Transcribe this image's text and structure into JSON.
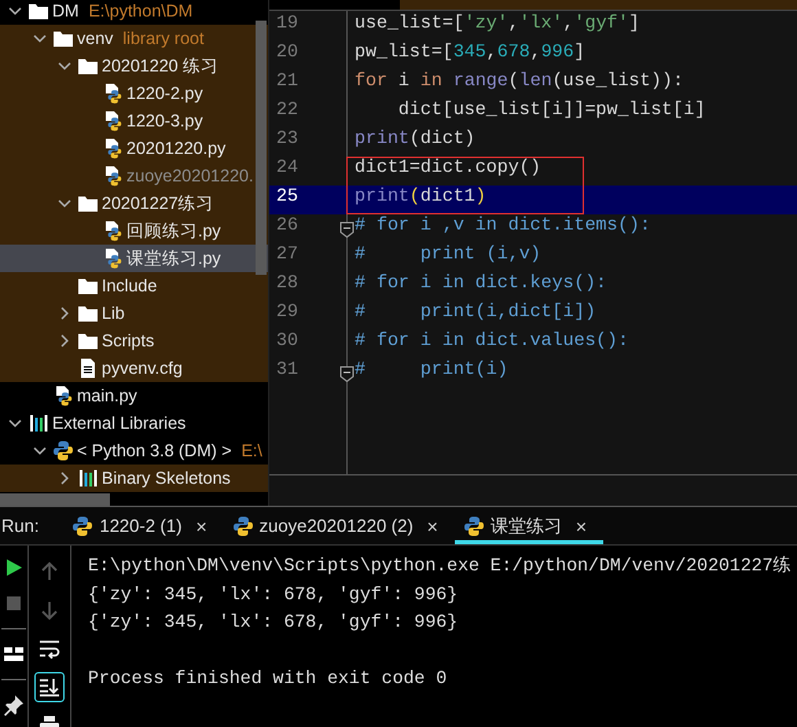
{
  "project_tree": {
    "items": [
      {
        "label": "DM",
        "detail": "E:\\python\\DM",
        "kind": "folder",
        "expanded": true,
        "selected": false,
        "dimmed": false,
        "library": false,
        "children": [
          {
            "label": "venv",
            "detail": "library root",
            "kind": "folder",
            "expanded": true,
            "selected": false,
            "dimmed": false,
            "library": true,
            "children": [
              {
                "label": "20201220 练习",
                "kind": "folder",
                "expanded": true,
                "selected": false,
                "dimmed": false,
                "library": true,
                "children": [
                  {
                    "label": "1220-2.py",
                    "kind": "python-file",
                    "selected": false,
                    "dimmed": false,
                    "library": true
                  },
                  {
                    "label": "1220-3.py",
                    "kind": "python-file",
                    "selected": false,
                    "dimmed": false,
                    "library": true
                  },
                  {
                    "label": "20201220.py",
                    "kind": "python-file",
                    "selected": false,
                    "dimmed": false,
                    "library": true
                  },
                  {
                    "label": "zuoye20201220.",
                    "kind": "python-file",
                    "selected": false,
                    "dimmed": true,
                    "library": true
                  }
                ]
              },
              {
                "label": "20201227练习",
                "kind": "folder",
                "expanded": true,
                "selected": false,
                "dimmed": false,
                "library": true,
                "children": [
                  {
                    "label": "回顾练习.py",
                    "kind": "python-file",
                    "selected": false,
                    "dimmed": false,
                    "library": true
                  },
                  {
                    "label": "课堂练习.py",
                    "kind": "python-file",
                    "selected": true,
                    "dimmed": false,
                    "library": true
                  }
                ]
              },
              {
                "label": "Include",
                "kind": "folder",
                "selected": false,
                "dimmed": false,
                "library": true
              },
              {
                "label": "Lib",
                "kind": "folder",
                "expanded": false,
                "selected": false,
                "dimmed": false,
                "library": true
              },
              {
                "label": "Scripts",
                "kind": "folder",
                "expanded": false,
                "selected": false,
                "dimmed": false,
                "library": true
              },
              {
                "label": "pyvenv.cfg",
                "kind": "text-file",
                "selected": false,
                "dimmed": false,
                "library": true
              }
            ]
          },
          {
            "label": "main.py",
            "kind": "python-file",
            "selected": false,
            "dimmed": false,
            "library": false
          }
        ]
      },
      {
        "label": "External Libraries",
        "kind": "library",
        "expanded": true,
        "selected": false,
        "dimmed": false,
        "library": false,
        "children": [
          {
            "label": "< Python 3.8 (DM) >",
            "detail": "E:\\",
            "kind": "python",
            "expanded": true,
            "selected": false,
            "dimmed": false,
            "library": false,
            "children": [
              {
                "label": "Binary Skeletons",
                "kind": "library",
                "expanded": false,
                "selected": false,
                "dimmed": false,
                "library": true
              }
            ]
          }
        ]
      }
    ]
  },
  "editor": {
    "lines": [
      {
        "number": "19",
        "current": false,
        "boxed": false,
        "fold": false,
        "tokens": [
          {
            "text": "use_list=[",
            "kind": "plain"
          },
          {
            "text": "'zy'",
            "kind": "string"
          },
          {
            "text": ",",
            "kind": "plain"
          },
          {
            "text": "'lx'",
            "kind": "string"
          },
          {
            "text": ",",
            "kind": "plain"
          },
          {
            "text": "'gyf'",
            "kind": "string"
          },
          {
            "text": "]",
            "kind": "plain"
          }
        ]
      },
      {
        "number": "20",
        "current": false,
        "boxed": false,
        "fold": false,
        "tokens": [
          {
            "text": "pw_list=[",
            "kind": "plain"
          },
          {
            "text": "345",
            "kind": "number"
          },
          {
            "text": ",",
            "kind": "plain"
          },
          {
            "text": "678",
            "kind": "number"
          },
          {
            "text": ",",
            "kind": "plain"
          },
          {
            "text": "996",
            "kind": "number"
          },
          {
            "text": "]",
            "kind": "plain"
          }
        ]
      },
      {
        "number": "21",
        "current": false,
        "boxed": false,
        "fold": false,
        "tokens": [
          {
            "text": "for",
            "kind": "keyword"
          },
          {
            "text": " i ",
            "kind": "plain"
          },
          {
            "text": "in ",
            "kind": "keyword"
          },
          {
            "text": "range",
            "kind": "builtin"
          },
          {
            "text": "(",
            "kind": "plain"
          },
          {
            "text": "len",
            "kind": "builtin"
          },
          {
            "text": "(use_list)):",
            "kind": "plain"
          }
        ]
      },
      {
        "number": "22",
        "current": false,
        "boxed": false,
        "fold": false,
        "tokens": [
          {
            "text": "    dict[use_list[i]]=pw_list[i]",
            "kind": "plain"
          }
        ]
      },
      {
        "number": "23",
        "current": false,
        "boxed": false,
        "fold": false,
        "tokens": [
          {
            "text": "print",
            "kind": "builtin"
          },
          {
            "text": "(dict)",
            "kind": "plain"
          }
        ]
      },
      {
        "number": "24",
        "current": false,
        "boxed": true,
        "fold": false,
        "tokens": [
          {
            "text": "dict1=dict.copy()",
            "kind": "plain"
          }
        ]
      },
      {
        "number": "25",
        "current": true,
        "boxed": true,
        "fold": false,
        "tokens": [
          {
            "text": "print",
            "kind": "builtin"
          },
          {
            "text": "(",
            "kind": "bracket"
          },
          {
            "text": "dict1",
            "kind": "plain"
          },
          {
            "text": ")",
            "kind": "bracket"
          }
        ]
      },
      {
        "number": "26",
        "current": false,
        "boxed": false,
        "fold": true,
        "tokens": [
          {
            "text": "# for i ,v in dict.items():",
            "kind": "comment"
          }
        ]
      },
      {
        "number": "27",
        "current": false,
        "boxed": false,
        "fold": false,
        "tokens": [
          {
            "text": "#     print (i,v)",
            "kind": "comment"
          }
        ]
      },
      {
        "number": "28",
        "current": false,
        "boxed": false,
        "fold": false,
        "tokens": [
          {
            "text": "# for i in dict.keys():",
            "kind": "comment"
          }
        ]
      },
      {
        "number": "29",
        "current": false,
        "boxed": false,
        "fold": false,
        "tokens": [
          {
            "text": "#     print(i,dict[i])",
            "kind": "comment"
          }
        ]
      },
      {
        "number": "30",
        "current": false,
        "boxed": false,
        "fold": false,
        "tokens": [
          {
            "text": "# for i in dict.values():",
            "kind": "comment"
          }
        ]
      },
      {
        "number": "31",
        "current": false,
        "boxed": false,
        "fold": true,
        "tokens": [
          {
            "text": "#     print(i)",
            "kind": "comment"
          }
        ]
      }
    ]
  },
  "run_panel": {
    "label": "Run:",
    "tabs": [
      {
        "label": "1220-2 (1)",
        "close": "×",
        "selected": false
      },
      {
        "label": "zuoye20201220 (2)",
        "close": "×",
        "selected": false
      },
      {
        "label": "课堂练习",
        "close": "×",
        "selected": true
      }
    ],
    "side_tools": [
      {
        "kind": "rerun"
      },
      {
        "kind": "stop"
      },
      {
        "kind": "layout"
      },
      {
        "kind": "pin"
      }
    ],
    "tools": [
      {
        "kind": "up",
        "on": false
      },
      {
        "kind": "down",
        "on": false
      },
      {
        "kind": "wrap",
        "on": false
      },
      {
        "kind": "scroll-end",
        "on": true
      },
      {
        "kind": "print",
        "on": false
      }
    ],
    "console": [
      {
        "kind": "command",
        "text": "E:\\python\\DM\\venv\\Scripts\\python.exe E:/python/DM/venv/20201227练"
      },
      {
        "kind": "output",
        "text": "{'zy': 345, 'lx': 678, 'gyf': 996}"
      },
      {
        "kind": "output",
        "text": "{'zy': 345, 'lx': 678, 'gyf': 996}"
      },
      {
        "kind": "exit",
        "text": "Process finished with exit code 0"
      }
    ]
  }
}
